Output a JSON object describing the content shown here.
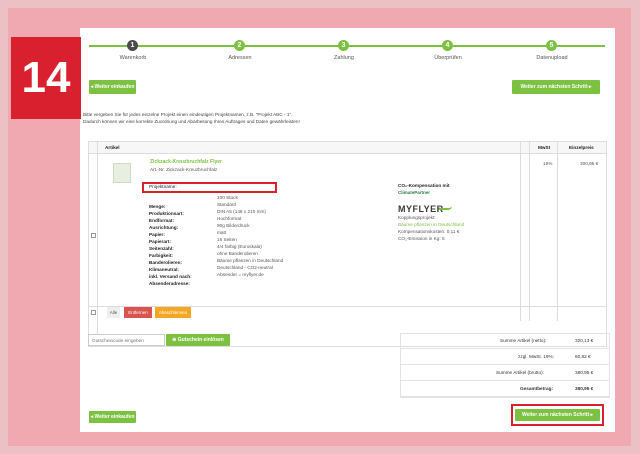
{
  "step_badge": "14",
  "steps": [
    {
      "num": "1",
      "label": "Warenkorb"
    },
    {
      "num": "2",
      "label": "Adressen"
    },
    {
      "num": "3",
      "label": "Zahlung"
    },
    {
      "num": "4",
      "label": "Überprüfen"
    },
    {
      "num": "5",
      "label": "Datenupload"
    }
  ],
  "buttons": {
    "continue_shopping": "◂ Weiter einkaufen",
    "next_step": "Weiter zum nächsten Schritt ▸",
    "remove": "Entfernen",
    "park": "Absschlennen",
    "all": "Alle",
    "redeem_voucher": "⊕ Gutschein einlösen"
  },
  "instructions": {
    "line1": "Bitte vergeben Sie für jedes einzelne Projekt einen eindeutigen Projektnamen, z.B. \"Projekt ABC - 1\".",
    "line2": "Dadurch können wir eine korrekte Zuordnung und Abarbeitung Ihres Auftrages und Daten gewährleisten!"
  },
  "table_headers": {
    "article": "Artikel",
    "vat": "MwSt",
    "unit_price": "Einzelpreis"
  },
  "product": {
    "name": "Zickzack-Kreuzbruchfalz Flyer",
    "article_no": "Art.-Nr. Zickzack-Kreuzbruchfalz",
    "vat": "19%",
    "price": "300,95 €",
    "project_name_label": "Projektname:",
    "project_name_value": "",
    "specs": [
      {
        "label": "Menge:",
        "value": "100 Stück"
      },
      {
        "label": "Produktionsart:",
        "value": "Standard"
      },
      {
        "label": "Endformat:",
        "value": "DIN A5 (148 x 210 mm)"
      },
      {
        "label": "Ausrichtung:",
        "value": "Hochformat"
      },
      {
        "label": "Papier:",
        "value": "90g Bilderdruck"
      },
      {
        "label": "Papierart:",
        "value": "matt"
      },
      {
        "label": "Seitenzahl:",
        "value": "16 Seiten"
      },
      {
        "label": "Farbigkeit:",
        "value": "4/4 farbig (Euroskala)"
      },
      {
        "label": "Banderolieren:",
        "value": "ohne Banderolieren"
      },
      {
        "label": "Klimaneutral:",
        "value": "Bäume pflanzen in Deutschland"
      },
      {
        "label": "inkl. Versand nach:",
        "value": "Deutschland - CO2-neutral"
      },
      {
        "label": "Absenderadresse:",
        "value": "Absender = myflyer.de"
      }
    ]
  },
  "co2": {
    "title": "CO₂-Kompensation mit",
    "partner": "ClimatePartner",
    "brand": "MYFLYER",
    "project_label": "Kopplungsprojekt:",
    "project": "Bäume pflanzen in Deutschland",
    "cost": "Kompensationskosten: 0,11 €",
    "emission": "CO₂-Emission in Kg: 5"
  },
  "voucher": {
    "placeholder": "Gutscheincode eingeben"
  },
  "summary": [
    {
      "label": "Summe Artikel (netto):",
      "value": "320,13 €"
    },
    {
      "label": "zzgl. MwSt. 19%:",
      "value": "60,82 €"
    },
    {
      "label": "Summe Artikel (brutto):",
      "value": "380,95 €"
    },
    {
      "label": "Gesamtbetrag:",
      "value": "380,95 €"
    }
  ],
  "colors": {
    "accent": "#7cc142",
    "highlight": "#d8202e",
    "orange": "#f5a623"
  }
}
